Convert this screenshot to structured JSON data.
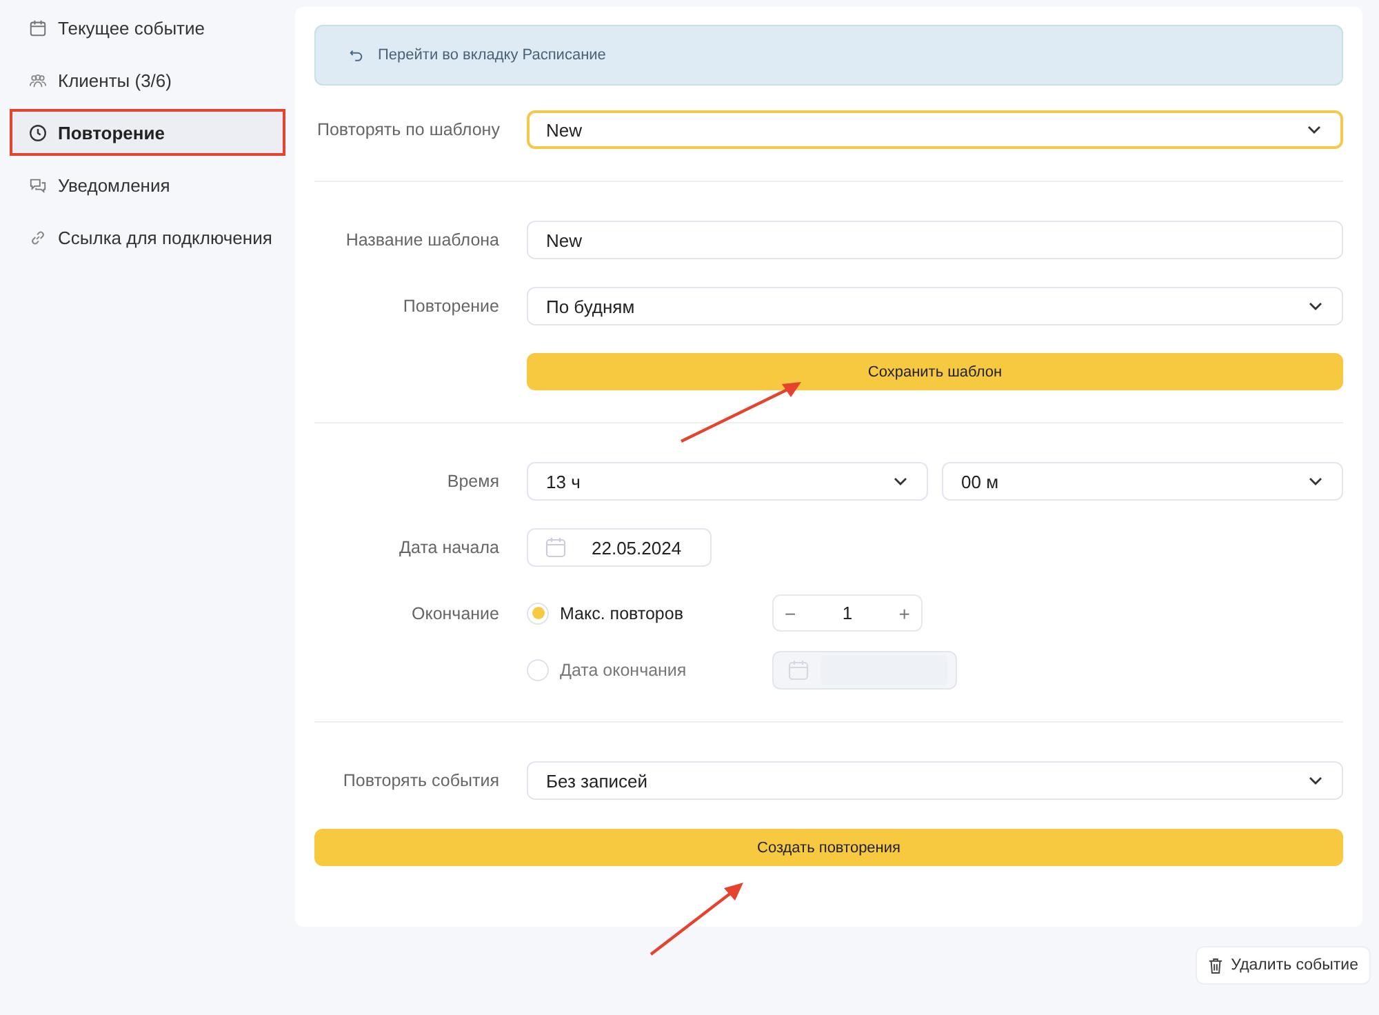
{
  "sidebar": {
    "items": [
      {
        "kind": "calendar",
        "label": "Текущее событие",
        "selected": false
      },
      {
        "kind": "people",
        "label": "Клиенты (3/6)",
        "selected": false
      },
      {
        "kind": "clock",
        "label": "Повторение",
        "selected": true
      },
      {
        "kind": "chat",
        "label": "Уведомления",
        "selected": false
      },
      {
        "kind": "link",
        "label": "Ссылка для подключения",
        "selected": false
      }
    ]
  },
  "banner": {
    "link": "Перейти во вкладку Расписание"
  },
  "template_select": {
    "label": "Повторять по шаблону",
    "value": "New"
  },
  "template_form": {
    "name": {
      "label": "Название шаблона",
      "value": "New"
    },
    "repeat": {
      "label": "Повторение",
      "value": "По будням"
    },
    "save_button": "Сохранить шаблон"
  },
  "schedule": {
    "time": {
      "label": "Время",
      "hours": "13 ч",
      "minutes": "00 м"
    },
    "start_date": {
      "label": "Дата начала",
      "value": "22.05.2024"
    },
    "ending": {
      "label": "Окончание",
      "options": [
        {
          "kind": "counter",
          "label": "Макс. повторов",
          "selected": true,
          "value": "1",
          "decrement": "−",
          "increment": "+"
        },
        {
          "kind": "date",
          "label": "Дата окончания",
          "selected": false
        }
      ]
    }
  },
  "repeat_events": {
    "label": "Повторять события",
    "value": "Без записей"
  },
  "create_button": "Создать повторения",
  "delete_button": "Удалить событие"
}
